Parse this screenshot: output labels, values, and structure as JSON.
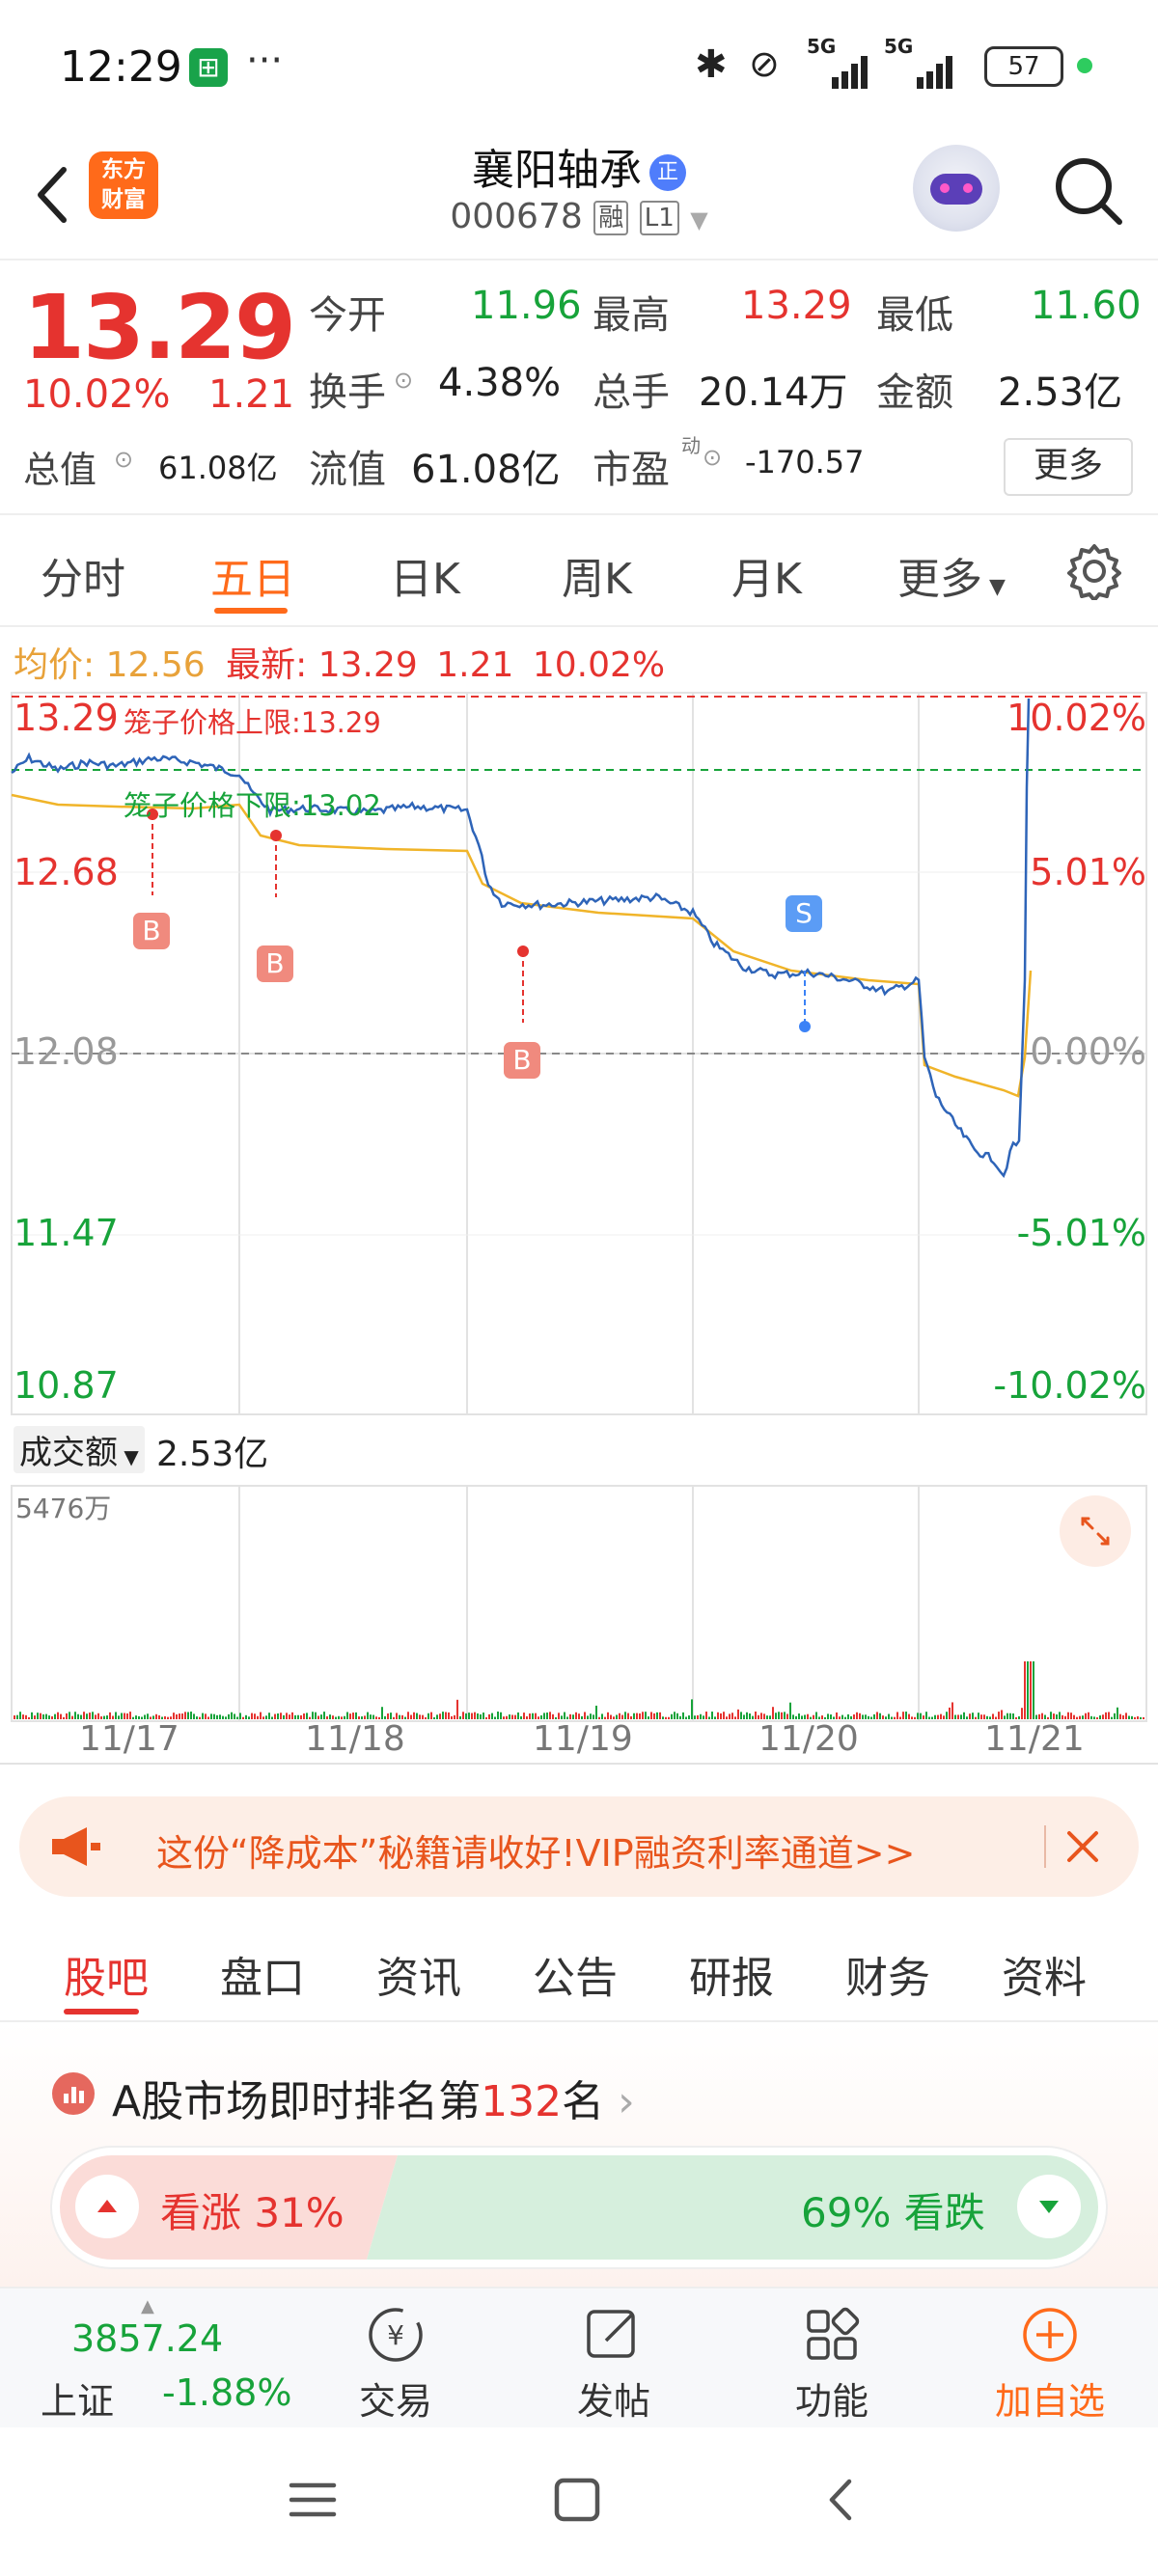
{
  "status_bar": {
    "time": "12:29",
    "network": "5G",
    "network2": "5G",
    "battery": "57"
  },
  "header": {
    "stock_name": "襄阳轴承",
    "stock_code": "000678",
    "tag_rong": "融",
    "tag_level": "L1",
    "badge": "正",
    "logo_line1": "东方",
    "logo_line2": "财富"
  },
  "quote": {
    "price": "13.29",
    "change_pct": "10.02%",
    "change": "1.21",
    "open_label": "今开",
    "open": "11.96",
    "high_label": "最高",
    "high": "13.29",
    "low_label": "最低",
    "low": "11.60",
    "turnover_label": "换手",
    "turnover": "4.38%",
    "volume_label": "总手",
    "volume": "20.14万",
    "amount_label": "金额",
    "amount": "2.53亿",
    "mcap_label": "总值",
    "mcap": "61.08亿",
    "float_label": "流值",
    "float": "61.08亿",
    "pe_label": "市盈",
    "pe_sup": "动",
    "pe": "-170.57",
    "more": "更多"
  },
  "tabs": [
    "分时",
    "五日",
    "日K",
    "周K",
    "月K",
    "更多"
  ],
  "chart": {
    "avg_label": "均价:",
    "avg": "12.56",
    "latest_label": "最新:",
    "latest": "13.29",
    "latest_change": "1.21",
    "latest_pct": "10.02%",
    "upper_limit": "笼子价格上限:13.29",
    "lower_limit": "笼子价格下限:13.02",
    "y_left": [
      "13.29",
      "12.68",
      "12.08",
      "11.47",
      "10.87"
    ],
    "y_right": [
      "10.02%",
      "5.01%",
      "0.00%",
      "-5.01%",
      "-10.02%"
    ],
    "markers": [
      "B",
      "B",
      "B",
      "S"
    ],
    "volume_label": "成交额",
    "volume_value": "2.53亿",
    "volume_max": "5476万",
    "dates": [
      "11/17",
      "11/18",
      "11/19",
      "11/20",
      "11/21"
    ]
  },
  "chart_data": {
    "type": "line",
    "title": "",
    "x": [
      "11/17",
      "11/18",
      "11/19",
      "11/20",
      "11/21"
    ],
    "ylim": [
      10.87,
      13.29
    ],
    "series": [
      {
        "name": "",
        "values": [
          12.75,
          12.68,
          12.45,
          12.15,
          13.29
        ]
      },
      {
        "name": "均价",
        "values": [
          12.72,
          12.67,
          12.42,
          12.2,
          12.56
        ]
      }
    ],
    "ylabel": "",
    "xlabel": ""
  },
  "banner": {
    "text": "这份“降成本”秘籍请收好!VIP融资利率通道>>"
  },
  "sub_tabs": [
    "股吧",
    "盘口",
    "资讯",
    "公告",
    "研报",
    "财务",
    "资料"
  ],
  "rank": {
    "prefix": "A股市场即时排名第",
    "num": "132",
    "suffix": "名"
  },
  "vote": {
    "up": "看涨 31%",
    "down": "69% 看跌",
    "up_pct": 31
  },
  "bottom_bar": {
    "index_value": "3857.24",
    "index_name": "上证",
    "index_change": "-1.88%",
    "trade": "交易",
    "post": "发帖",
    "func": "功能",
    "add": "加自选"
  }
}
